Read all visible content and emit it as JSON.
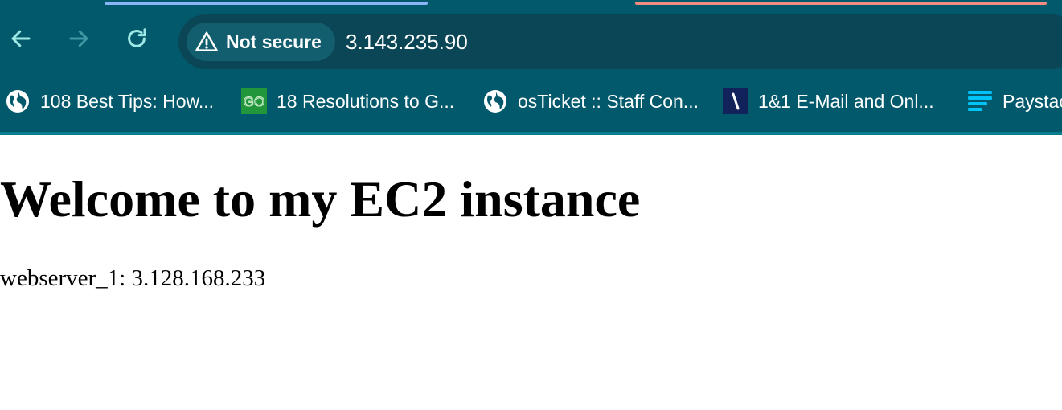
{
  "browser": {
    "tabs": {
      "active_indicator_color": "#8ab4f8",
      "other_indicator_color": "#f28b82"
    },
    "toolbar": {
      "back_icon": "arrow-left-icon",
      "forward_icon": "arrow-right-icon",
      "reload_icon": "reload-icon",
      "icon_color": "#9ee9e4",
      "forward_disabled_color": "#3e99a3"
    },
    "omnibox": {
      "security_label": "Not secure",
      "security_icon": "warning-triangle-icon",
      "url": "3.143.235.90"
    },
    "bookmarks": [
      {
        "label": "108 Best Tips: How...",
        "icon": "globe-icon"
      },
      {
        "label": "18 Resolutions to G...",
        "icon": "go-logo-icon",
        "icon_text": "GO",
        "icon_color": "#22963b"
      },
      {
        "label": "osTicket :: Staff Con...",
        "icon": "globe-icon"
      },
      {
        "label": "1&1 E-Mail and Onl...",
        "icon": "ionos-logo-icon",
        "icon_color": "#11235a"
      },
      {
        "label": "Paystac",
        "icon": "paystack-logo-icon",
        "icon_color": "#00c3f7"
      }
    ],
    "theme": {
      "toolbar_bg": "#03596c",
      "omnibox_bg": "#0b4656",
      "chip_bg": "#135e6e"
    }
  },
  "page": {
    "title": "Welcome to my EC2 instance",
    "server_info": "webserver_1: 3.128.168.233"
  }
}
